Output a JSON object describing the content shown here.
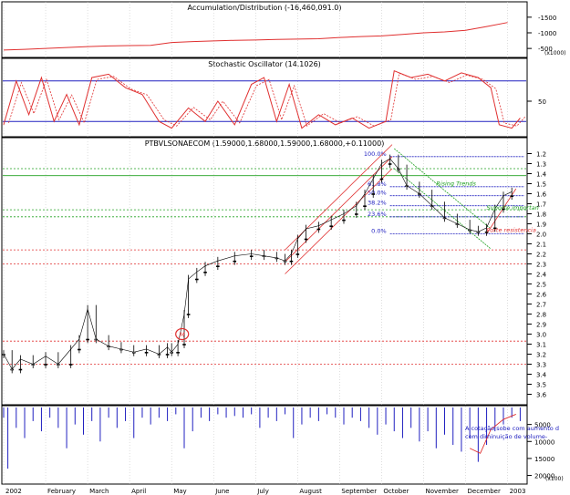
{
  "chart_data": {
    "type": "candlestick",
    "x_month_labels": [
      "2002",
      "February",
      "March",
      "April",
      "May",
      "June",
      "July",
      "August",
      "September",
      "October",
      "November",
      "December",
      "2003"
    ],
    "panels": {
      "accumulation_distribution": {
        "title": "Accumulation/Distribution (-16,460,091.0)",
        "y_ticks": [
          "-500",
          "-1000",
          "-1500"
        ],
        "y_range": [
          -1700,
          -300
        ],
        "unit_label": "(x1000)",
        "series": [
          {
            "x": 0,
            "y": -450
          },
          {
            "x": 0.5,
            "y": -470
          },
          {
            "x": 1,
            "y": -500
          },
          {
            "x": 1.5,
            "y": -530
          },
          {
            "x": 2,
            "y": -560
          },
          {
            "x": 2.5,
            "y": -580
          },
          {
            "x": 3,
            "y": -590
          },
          {
            "x": 3.5,
            "y": -600
          },
          {
            "x": 4,
            "y": -690
          },
          {
            "x": 4.5,
            "y": -720
          },
          {
            "x": 5,
            "y": -740
          },
          {
            "x": 5.5,
            "y": -760
          },
          {
            "x": 6,
            "y": -770
          },
          {
            "x": 6.5,
            "y": -790
          },
          {
            "x": 7,
            "y": -800
          },
          {
            "x": 7.5,
            "y": -810
          },
          {
            "x": 8,
            "y": -850
          },
          {
            "x": 8.5,
            "y": -880
          },
          {
            "x": 9,
            "y": -900
          },
          {
            "x": 9.5,
            "y": -950
          },
          {
            "x": 10,
            "y": -1000
          },
          {
            "x": 10.5,
            "y": -1030
          },
          {
            "x": 11,
            "y": -1080
          },
          {
            "x": 11.5,
            "y": -1200
          },
          {
            "x": 12,
            "y": -1330
          }
        ]
      },
      "stochastic": {
        "title": "Stochastic Oscillator (14.1026)",
        "y_ticks": [
          "50"
        ],
        "y_range": [
          0,
          100
        ],
        "ref_lines": [
          80,
          20
        ],
        "k_series": [
          {
            "x": 0,
            "y": 15
          },
          {
            "x": 0.3,
            "y": 80
          },
          {
            "x": 0.6,
            "y": 30
          },
          {
            "x": 0.9,
            "y": 85
          },
          {
            "x": 1.2,
            "y": 20
          },
          {
            "x": 1.5,
            "y": 60
          },
          {
            "x": 1.8,
            "y": 15
          },
          {
            "x": 2.1,
            "y": 85
          },
          {
            "x": 2.5,
            "y": 90
          },
          {
            "x": 2.9,
            "y": 70
          },
          {
            "x": 3.3,
            "y": 60
          },
          {
            "x": 3.7,
            "y": 20
          },
          {
            "x": 4.0,
            "y": 10
          },
          {
            "x": 4.4,
            "y": 40
          },
          {
            "x": 4.8,
            "y": 20
          },
          {
            "x": 5.1,
            "y": 50
          },
          {
            "x": 5.5,
            "y": 15
          },
          {
            "x": 5.9,
            "y": 75
          },
          {
            "x": 6.2,
            "y": 85
          },
          {
            "x": 6.5,
            "y": 20
          },
          {
            "x": 6.8,
            "y": 75
          },
          {
            "x": 7.1,
            "y": 10
          },
          {
            "x": 7.5,
            "y": 30
          },
          {
            "x": 7.9,
            "y": 15
          },
          {
            "x": 8.3,
            "y": 25
          },
          {
            "x": 8.7,
            "y": 10
          },
          {
            "x": 9.1,
            "y": 20
          },
          {
            "x": 9.3,
            "y": 95
          },
          {
            "x": 9.7,
            "y": 85
          },
          {
            "x": 10.1,
            "y": 90
          },
          {
            "x": 10.5,
            "y": 80
          },
          {
            "x": 10.9,
            "y": 92
          },
          {
            "x": 11.3,
            "y": 85
          },
          {
            "x": 11.6,
            "y": 70
          },
          {
            "x": 11.8,
            "y": 15
          },
          {
            "x": 12.1,
            "y": 10
          },
          {
            "x": 12.3,
            "y": 25
          }
        ]
      },
      "price": {
        "title": "PTBVLSONAECOM (1.59000,1.68000,1.59000,1.68000,+0.11000)",
        "y_ticks": [
          "3.6",
          "3.5",
          "3.4",
          "3.3",
          "3.2",
          "3.1",
          "3.0",
          "2.9",
          "2.8",
          "2.7",
          "2.6",
          "2.5",
          "2.4",
          "2.3",
          "2.2",
          "2.1",
          "2.0",
          "1.9",
          "1.8",
          "1.7",
          "1.6",
          "1.5",
          "1.4",
          "1.3",
          "1.2"
        ],
        "y_range": [
          1.15,
          3.65
        ],
        "horizontal_lines": [
          {
            "y": 3.3,
            "color": "#e03030",
            "dashed": true
          },
          {
            "y": 3.07,
            "color": "#e03030",
            "dashed": true
          },
          {
            "y": 2.3,
            "color": "#e03030",
            "dashed": true
          },
          {
            "y": 2.16,
            "color": "#e03030",
            "dashed": true
          },
          {
            "y": 1.83,
            "color": "#20a020",
            "dashed": true
          },
          {
            "y": 1.76,
            "color": "#20a020",
            "dashed": true
          },
          {
            "y": 1.42,
            "color": "#20a020",
            "dashed": false
          },
          {
            "y": 1.35,
            "color": "#20a020",
            "dashed": true
          }
        ],
        "fibonacci": [
          {
            "label": "0.0%",
            "y": 2.0
          },
          {
            "label": "23.6%",
            "y": 1.83
          },
          {
            "label": "38.2%",
            "y": 1.72
          },
          {
            "label": "50.0%",
            "y": 1.62
          },
          {
            "label": "61.8%",
            "y": 1.53
          },
          {
            "label": "100.0%",
            "y": 1.23
          }
        ],
        "annotations": [
          {
            "text": "Rising Trends",
            "x": 10.3,
            "y": 1.52,
            "color": "#20a020"
          },
          {
            "text": "Forte resistencia",
            "x": 11.5,
            "y": 1.98,
            "color": "#e03030"
          },
          {
            "text": "Suporte importan",
            "x": 11.5,
            "y": 1.76,
            "color": "#20a020"
          }
        ],
        "circle_marker": {
          "x": 4.25,
          "y": 3.0,
          "label": "M"
        },
        "series_close": [
          {
            "x": 0,
            "y": 3.2
          },
          {
            "x": 0.2,
            "y": 3.35
          },
          {
            "x": 0.4,
            "y": 3.25
          },
          {
            "x": 0.7,
            "y": 3.3
          },
          {
            "x": 1.0,
            "y": 3.22
          },
          {
            "x": 1.3,
            "y": 3.3
          },
          {
            "x": 1.6,
            "y": 3.15
          },
          {
            "x": 1.8,
            "y": 3.05
          },
          {
            "x": 2.0,
            "y": 2.75
          },
          {
            "x": 2.2,
            "y": 3.05
          },
          {
            "x": 2.5,
            "y": 3.12
          },
          {
            "x": 2.8,
            "y": 3.15
          },
          {
            "x": 3.1,
            "y": 3.18
          },
          {
            "x": 3.4,
            "y": 3.15
          },
          {
            "x": 3.7,
            "y": 3.2
          },
          {
            "x": 3.9,
            "y": 3.13
          },
          {
            "x": 4.0,
            "y": 3.18
          },
          {
            "x": 4.15,
            "y": 3.1
          },
          {
            "x": 4.3,
            "y": 2.8
          },
          {
            "x": 4.4,
            "y": 2.45
          },
          {
            "x": 4.6,
            "y": 2.38
          },
          {
            "x": 4.8,
            "y": 2.32
          },
          {
            "x": 5.1,
            "y": 2.27
          },
          {
            "x": 5.5,
            "y": 2.22
          },
          {
            "x": 5.9,
            "y": 2.2
          },
          {
            "x": 6.2,
            "y": 2.22
          },
          {
            "x": 6.5,
            "y": 2.24
          },
          {
            "x": 6.7,
            "y": 2.27
          },
          {
            "x": 6.85,
            "y": 2.2
          },
          {
            "x": 7.0,
            "y": 2.05
          },
          {
            "x": 7.2,
            "y": 1.95
          },
          {
            "x": 7.5,
            "y": 1.92
          },
          {
            "x": 7.8,
            "y": 1.86
          },
          {
            "x": 8.1,
            "y": 1.8
          },
          {
            "x": 8.4,
            "y": 1.72
          },
          {
            "x": 8.6,
            "y": 1.6
          },
          {
            "x": 8.8,
            "y": 1.45
          },
          {
            "x": 9.0,
            "y": 1.3
          },
          {
            "x": 9.2,
            "y": 1.25
          },
          {
            "x": 9.4,
            "y": 1.35
          },
          {
            "x": 9.6,
            "y": 1.52
          },
          {
            "x": 9.9,
            "y": 1.6
          },
          {
            "x": 10.2,
            "y": 1.72
          },
          {
            "x": 10.5,
            "y": 1.84
          },
          {
            "x": 10.8,
            "y": 1.9
          },
          {
            "x": 11.1,
            "y": 1.96
          },
          {
            "x": 11.3,
            "y": 1.98
          },
          {
            "x": 11.5,
            "y": 1.94
          },
          {
            "x": 11.7,
            "y": 1.75
          },
          {
            "x": 11.9,
            "y": 1.62
          },
          {
            "x": 12.1,
            "y": 1.58
          }
        ]
      },
      "volume": {
        "y_ticks": [
          "20000",
          "15000",
          "10000",
          "5000"
        ],
        "y_range": [
          0,
          22000
        ],
        "unit_label": "(x100)",
        "annotation": "A cotação sobe com aumento d com diminuição de volume-",
        "bars": [
          {
            "x": 0,
            "y": 3000
          },
          {
            "x": 0.1,
            "y": 18000
          },
          {
            "x": 0.3,
            "y": 6000
          },
          {
            "x": 0.5,
            "y": 9000
          },
          {
            "x": 0.7,
            "y": 4000
          },
          {
            "x": 0.9,
            "y": 7000
          },
          {
            "x": 1.1,
            "y": 3000
          },
          {
            "x": 1.3,
            "y": 6000
          },
          {
            "x": 1.5,
            "y": 12000
          },
          {
            "x": 1.7,
            "y": 5000
          },
          {
            "x": 1.9,
            "y": 8000
          },
          {
            "x": 2.1,
            "y": 4000
          },
          {
            "x": 2.3,
            "y": 10000
          },
          {
            "x": 2.5,
            "y": 3000
          },
          {
            "x": 2.7,
            "y": 6000
          },
          {
            "x": 2.9,
            "y": 4000
          },
          {
            "x": 3.1,
            "y": 9000
          },
          {
            "x": 3.3,
            "y": 3000
          },
          {
            "x": 3.5,
            "y": 5000
          },
          {
            "x": 3.7,
            "y": 3000
          },
          {
            "x": 3.9,
            "y": 4000
          },
          {
            "x": 4.1,
            "y": 2000
          },
          {
            "x": 4.3,
            "y": 12000
          },
          {
            "x": 4.5,
            "y": 7000
          },
          {
            "x": 4.7,
            "y": 3000
          },
          {
            "x": 4.9,
            "y": 4000
          },
          {
            "x": 5.1,
            "y": 2000
          },
          {
            "x": 5.3,
            "y": 3000
          },
          {
            "x": 5.5,
            "y": 2500
          },
          {
            "x": 5.7,
            "y": 3000
          },
          {
            "x": 5.9,
            "y": 2000
          },
          {
            "x": 6.1,
            "y": 6000
          },
          {
            "x": 6.3,
            "y": 3000
          },
          {
            "x": 6.5,
            "y": 4000
          },
          {
            "x": 6.7,
            "y": 2000
          },
          {
            "x": 6.9,
            "y": 9000
          },
          {
            "x": 7.1,
            "y": 5000
          },
          {
            "x": 7.3,
            "y": 3000
          },
          {
            "x": 7.5,
            "y": 4000
          },
          {
            "x": 7.7,
            "y": 2000
          },
          {
            "x": 7.9,
            "y": 3000
          },
          {
            "x": 8.1,
            "y": 5000
          },
          {
            "x": 8.3,
            "y": 3000
          },
          {
            "x": 8.5,
            "y": 4000
          },
          {
            "x": 8.7,
            "y": 6000
          },
          {
            "x": 8.9,
            "y": 8000
          },
          {
            "x": 9.1,
            "y": 5000
          },
          {
            "x": 9.3,
            "y": 7000
          },
          {
            "x": 9.5,
            "y": 9000
          },
          {
            "x": 9.7,
            "y": 6000
          },
          {
            "x": 9.9,
            "y": 10000
          },
          {
            "x": 10.1,
            "y": 7000
          },
          {
            "x": 10.3,
            "y": 12000
          },
          {
            "x": 10.5,
            "y": 8000
          },
          {
            "x": 10.7,
            "y": 11000
          },
          {
            "x": 10.9,
            "y": 13000
          },
          {
            "x": 11.1,
            "y": 9000
          },
          {
            "x": 11.3,
            "y": 16000
          },
          {
            "x": 11.5,
            "y": 11000
          },
          {
            "x": 11.7,
            "y": 7000
          },
          {
            "x": 11.9,
            "y": 5000
          },
          {
            "x": 12.1,
            "y": 3000
          },
          {
            "x": 12.3,
            "y": 4000
          }
        ]
      }
    }
  },
  "colors": {
    "price_candle": "#000000",
    "stochastic_k": "#e03030",
    "stochastic_d": "#e03030",
    "ref_line": "#2020c0",
    "volume_bar": "#2020c0",
    "fib_line": "#2020c0",
    "channel": "#e03030",
    "channel_up": "#20a020"
  }
}
